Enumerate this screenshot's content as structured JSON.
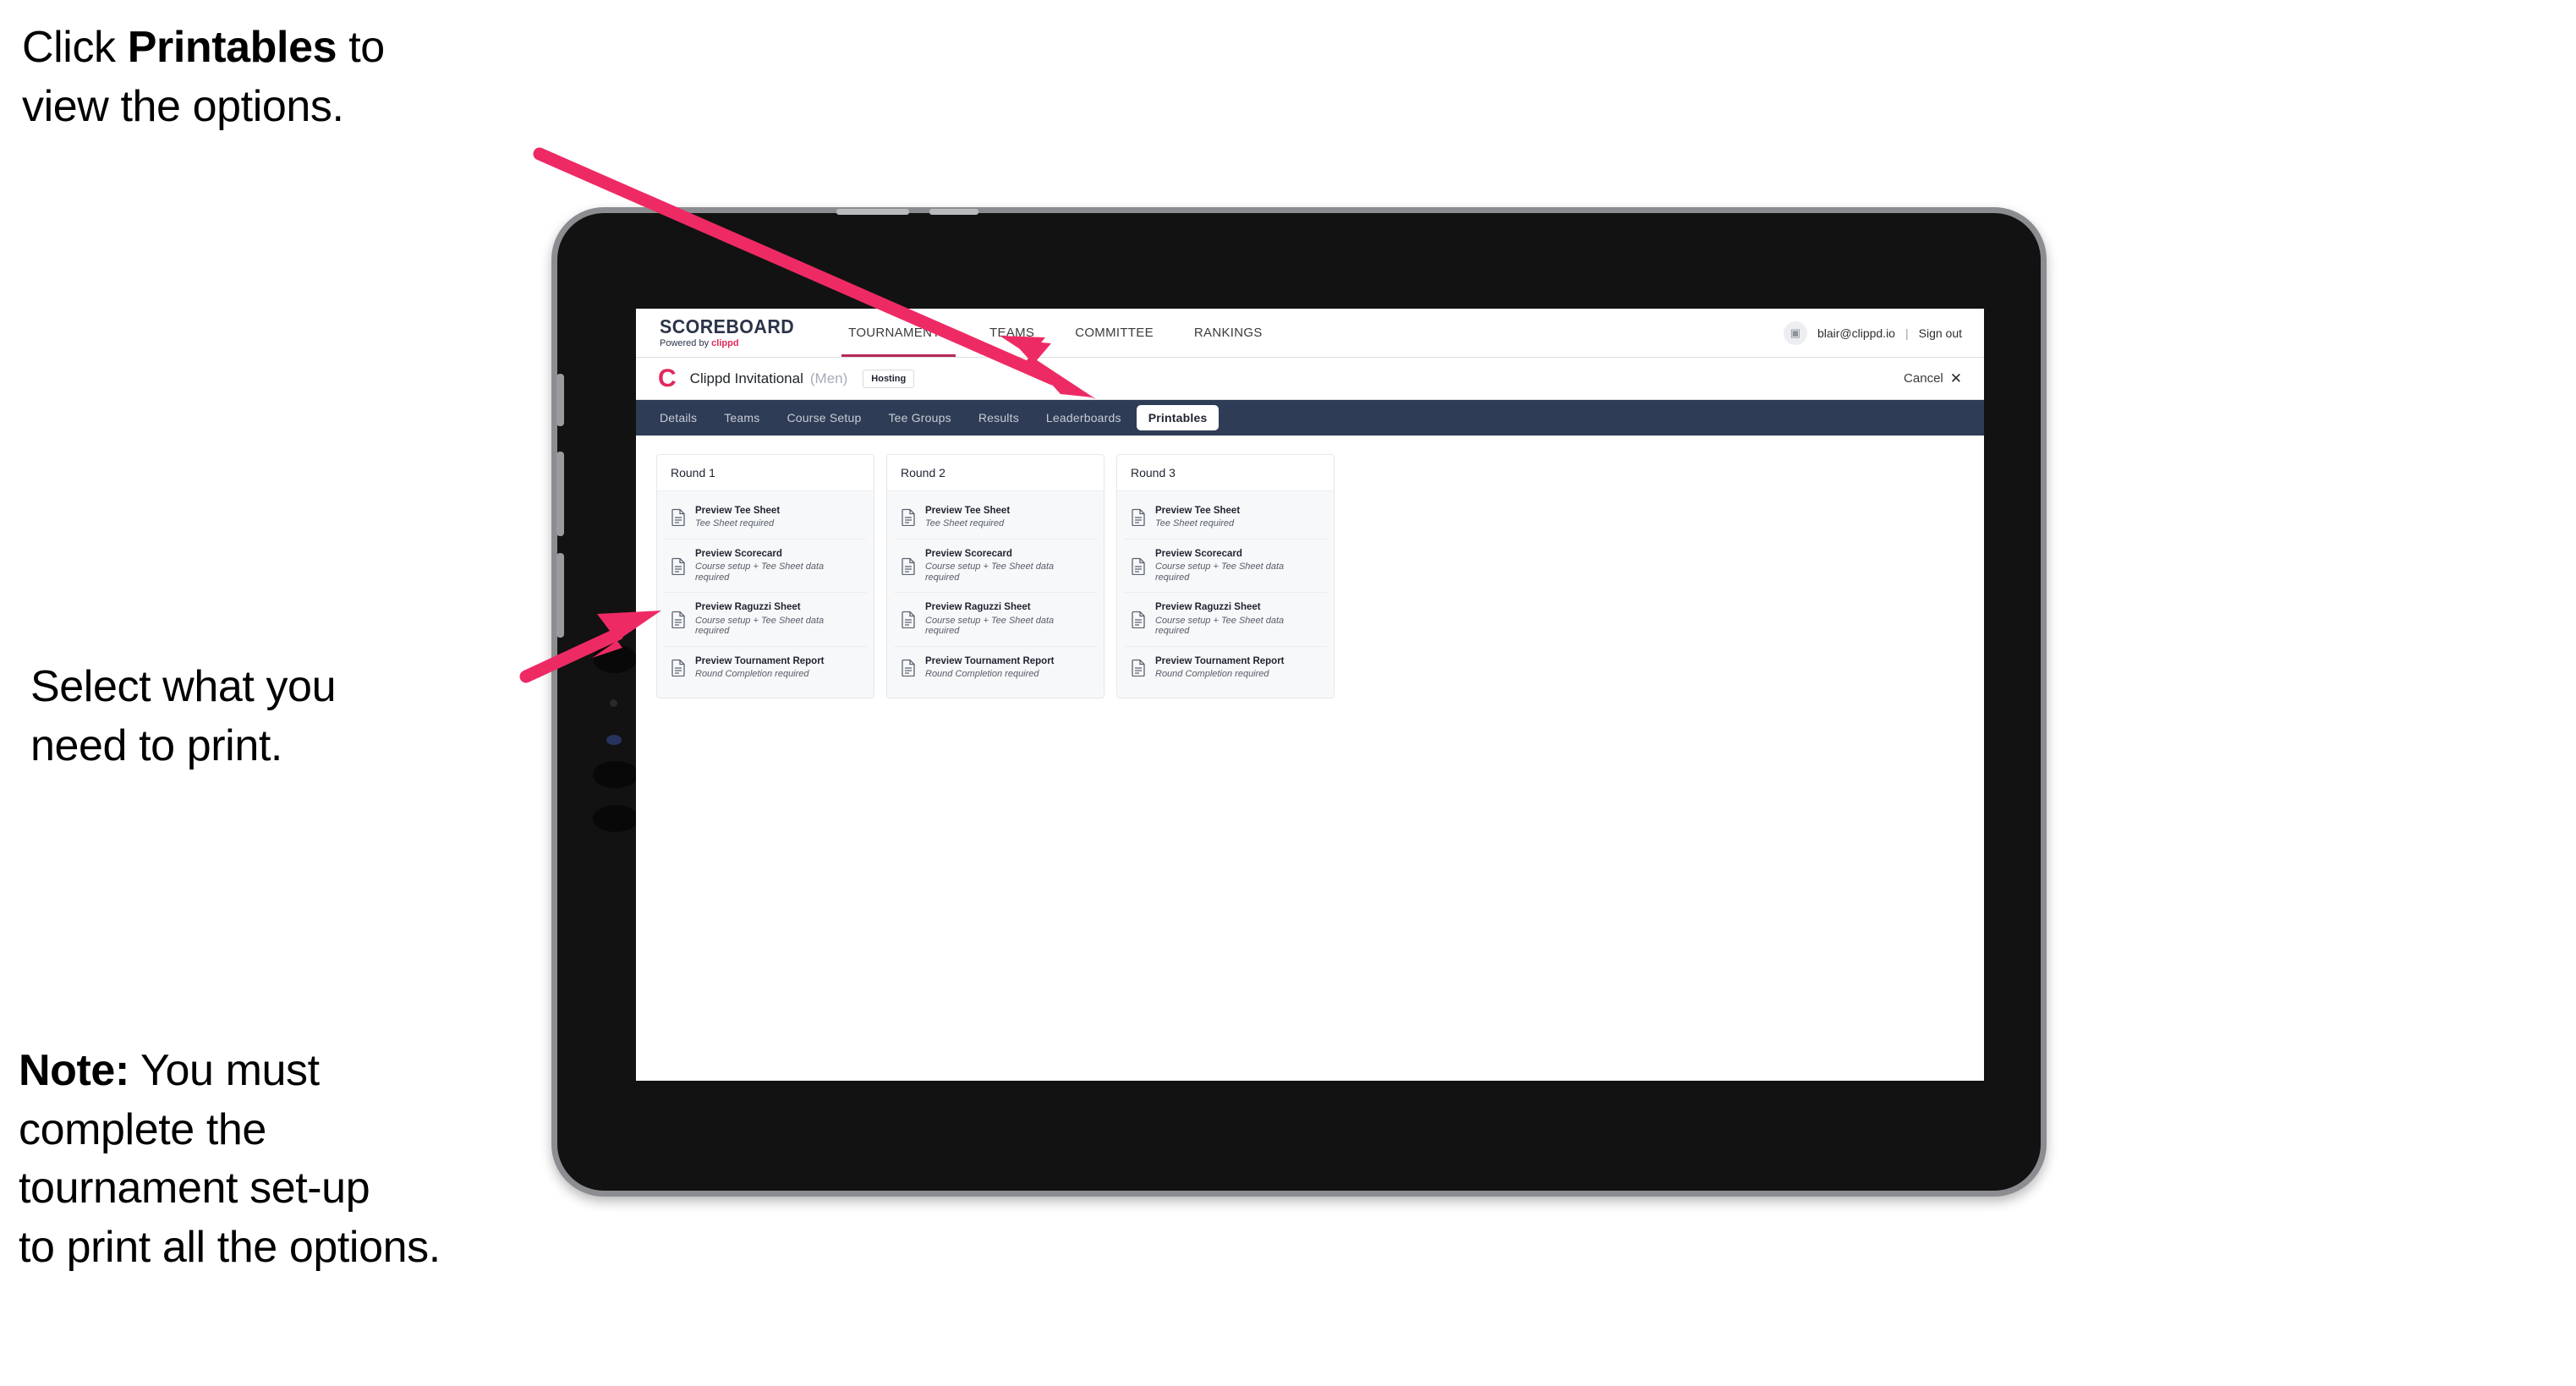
{
  "annotations": {
    "top": {
      "prefix": "Click ",
      "bold": "Printables",
      "suffix": " to\nview the options."
    },
    "middle": "Select what you\n need to print.",
    "note": {
      "bold": "Note:",
      "rest": " You must\ncomplete the\ntournament set-up\nto print all the options."
    }
  },
  "colors": {
    "arrow_pink": "#ee2a64",
    "accent_crimson": "#e0295c",
    "tabbar_navy": "#2f3c55",
    "nav_underline": "#b7295a"
  },
  "app": {
    "brand": {
      "title": "SCOREBOARD",
      "powered_prefix": "Powered by ",
      "powered_name": "clippd"
    },
    "nav": [
      {
        "label": "TOURNAMENTS",
        "active": true
      },
      {
        "label": "TEAMS",
        "active": false
      },
      {
        "label": "COMMITTEE",
        "active": false
      },
      {
        "label": "RANKINGS",
        "active": false
      }
    ],
    "user": {
      "avatar_glyph": "▣",
      "email": "blair@clippd.io",
      "separator": "|",
      "sign_out": "Sign out"
    },
    "tournament": {
      "logo_letter": "C",
      "name": "Clippd Invitational",
      "gender": "(Men)",
      "status_badge": "Hosting",
      "cancel_label": "Cancel",
      "cancel_icon": "✕"
    },
    "tabs": [
      {
        "label": "Details",
        "active": false
      },
      {
        "label": "Teams",
        "active": false
      },
      {
        "label": "Course Setup",
        "active": false
      },
      {
        "label": "Tee Groups",
        "active": false
      },
      {
        "label": "Results",
        "active": false
      },
      {
        "label": "Leaderboards",
        "active": false
      },
      {
        "label": "Printables",
        "active": true
      }
    ],
    "rounds": [
      {
        "title": "Round 1",
        "documents": [
          {
            "title": "Preview Tee Sheet",
            "requirement": "Tee Sheet required"
          },
          {
            "title": "Preview Scorecard",
            "requirement": "Course setup + Tee Sheet data required"
          },
          {
            "title": "Preview Raguzzi Sheet",
            "requirement": "Course setup + Tee Sheet data required"
          },
          {
            "title": "Preview Tournament Report",
            "requirement": "Round Completion required"
          }
        ]
      },
      {
        "title": "Round 2",
        "documents": [
          {
            "title": "Preview Tee Sheet",
            "requirement": "Tee Sheet required"
          },
          {
            "title": "Preview Scorecard",
            "requirement": "Course setup + Tee Sheet data required"
          },
          {
            "title": "Preview Raguzzi Sheet",
            "requirement": "Course setup + Tee Sheet data required"
          },
          {
            "title": "Preview Tournament Report",
            "requirement": "Round Completion required"
          }
        ]
      },
      {
        "title": "Round 3",
        "documents": [
          {
            "title": "Preview Tee Sheet",
            "requirement": "Tee Sheet required"
          },
          {
            "title": "Preview Scorecard",
            "requirement": "Course setup + Tee Sheet data required"
          },
          {
            "title": "Preview Raguzzi Sheet",
            "requirement": "Course setup + Tee Sheet data required"
          },
          {
            "title": "Preview Tournament Report",
            "requirement": "Round Completion required"
          }
        ]
      }
    ]
  }
}
